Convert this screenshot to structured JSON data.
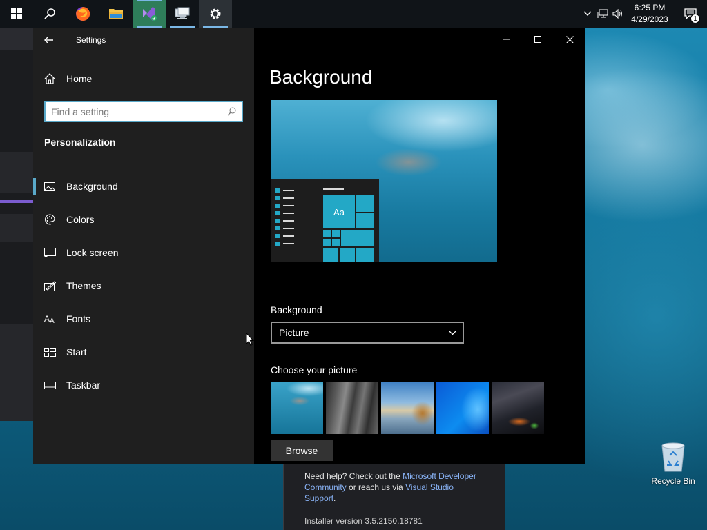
{
  "taskbar": {
    "apps": [
      {
        "name": "Start"
      },
      {
        "name": "Search"
      },
      {
        "name": "Firefox"
      },
      {
        "name": "File Explorer"
      },
      {
        "name": "Visual Studio Installer"
      },
      {
        "name": "Remote Desktop"
      },
      {
        "name": "Settings"
      }
    ],
    "clock": {
      "time": "6:25 PM",
      "date": "4/29/2023"
    },
    "notification_count": "1"
  },
  "settings": {
    "app_title": "Settings",
    "home_label": "Home",
    "search_placeholder": "Find a setting",
    "section_title": "Personalization",
    "nav_items": [
      {
        "label": "Background",
        "icon": "picture-icon",
        "selected": true
      },
      {
        "label": "Colors",
        "icon": "palette-icon",
        "selected": false
      },
      {
        "label": "Lock screen",
        "icon": "lock-screen-icon",
        "selected": false
      },
      {
        "label": "Themes",
        "icon": "themes-icon",
        "selected": false
      },
      {
        "label": "Fonts",
        "icon": "fonts-icon",
        "selected": false
      },
      {
        "label": "Start",
        "icon": "start-icon",
        "selected": false
      },
      {
        "label": "Taskbar",
        "icon": "taskbar-icon",
        "selected": false
      }
    ],
    "content": {
      "page_title": "Background",
      "preview_sample_text": "Aa",
      "background_label": "Background",
      "background_value": "Picture",
      "choose_picture_label": "Choose your picture",
      "browse_label": "Browse"
    }
  },
  "installer": {
    "help_prefix": "Need help? Check out the ",
    "help_link1": "Microsoft Developer Community",
    "help_middle": " or reach us via ",
    "help_link2": "Visual Studio Support",
    "help_suffix": ".",
    "version_text": "Installer version 3.5.2150.18781"
  },
  "desktop": {
    "recycle_bin_label": "Recycle Bin"
  },
  "colors": {
    "accent": "#5aa9c9",
    "tile": "#23a8c6",
    "taskbar": "#101418",
    "nav_pane": "#1f1f1f"
  }
}
